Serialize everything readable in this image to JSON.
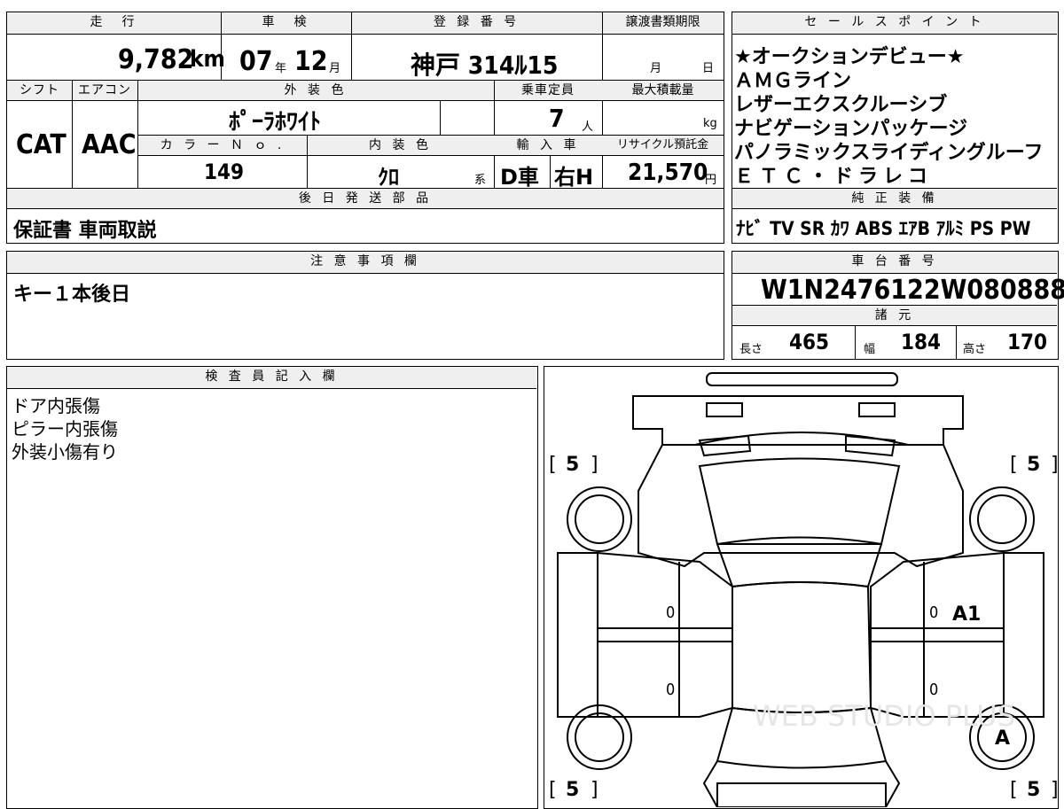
{
  "vehicle": {
    "mileage_label": "走　行",
    "mileage_value": "9,782",
    "mileage_unit": "km",
    "inspection_label": "車　検",
    "inspection_year": "07",
    "inspection_year_unit": "年",
    "inspection_month": "12",
    "inspection_month_unit": "月",
    "registration_label": "登 録 番 号",
    "registration_value": "神戸 314ﾙ15",
    "transfer_deadline_label": "譲渡書類期限",
    "transfer_month_unit": "月",
    "transfer_day_unit": "日",
    "shift_label": "シフト",
    "shift_value": "CAT",
    "aircon_label": "エアコン",
    "aircon_value": "AAC",
    "exterior_color_label": "外 装 色",
    "exterior_color_value": "ﾎﾟｰﾗﾎﾜｲﾄ",
    "capacity_label": "乗車定員",
    "capacity_value": "7",
    "capacity_unit": "人",
    "max_load_label": "最大積載量",
    "max_load_unit": "kg",
    "color_no_label": "カ ラ ー Ｎ ｏ .",
    "color_no_value": "149",
    "interior_color_label": "内 装 色",
    "interior_color_value": "ｸﾛ",
    "interior_color_suffix": "系",
    "import_label": "輸 入 車",
    "import_type": "D車",
    "steering": "右H",
    "recycle_label": "リサイクル預託金",
    "recycle_value": "21,570",
    "recycle_unit": "円"
  },
  "deferred_parts": {
    "label": "後 日 発 送 部 品",
    "value": "保証書 車両取説"
  },
  "sales_points": {
    "label": "セ ー ル ス ポ イ ン ト",
    "items": [
      "★オークションデビュー★",
      "ＡＭＧライン",
      "レザーエクスクルーシブ",
      "ナビゲーションパッケージ",
      "パノラミックスライディングルーフ",
      "ＥＴＣ・ドラレコ"
    ]
  },
  "equipment": {
    "label": "純 正 装 備",
    "value": "ﾅﾋﾞ TV SR ｶﾜ ABS ｴｱB ｱﾙﾐ PS PW"
  },
  "notes": {
    "label": "注 意 事 項 欄",
    "value": "キー１本後日"
  },
  "chassis": {
    "label": "車 台 番 号",
    "value": "W1N2476122W080888"
  },
  "dimensions": {
    "label": "諸 元",
    "length_label": "長さ",
    "length_value": "465",
    "width_label": "幅",
    "width_value": "184",
    "height_label": "高さ",
    "height_value": "170"
  },
  "inspector": {
    "label": "検 査 員 記 入 欄",
    "lines": [
      "ドア内張傷",
      "ピラー内張傷",
      "外装小傷有り"
    ]
  },
  "diagram": {
    "tire_front_left": "5",
    "tire_front_right": "5",
    "tire_rear_left": "5",
    "tire_rear_right": "5",
    "door_front_left": "0",
    "door_rear_left": "0",
    "door_front_right": "0",
    "door_rear_right": "0",
    "mark_front_right_door": "A1",
    "mark_rear_right_wheel": "A",
    "watermark": "WEB STUDIO PLUS"
  }
}
